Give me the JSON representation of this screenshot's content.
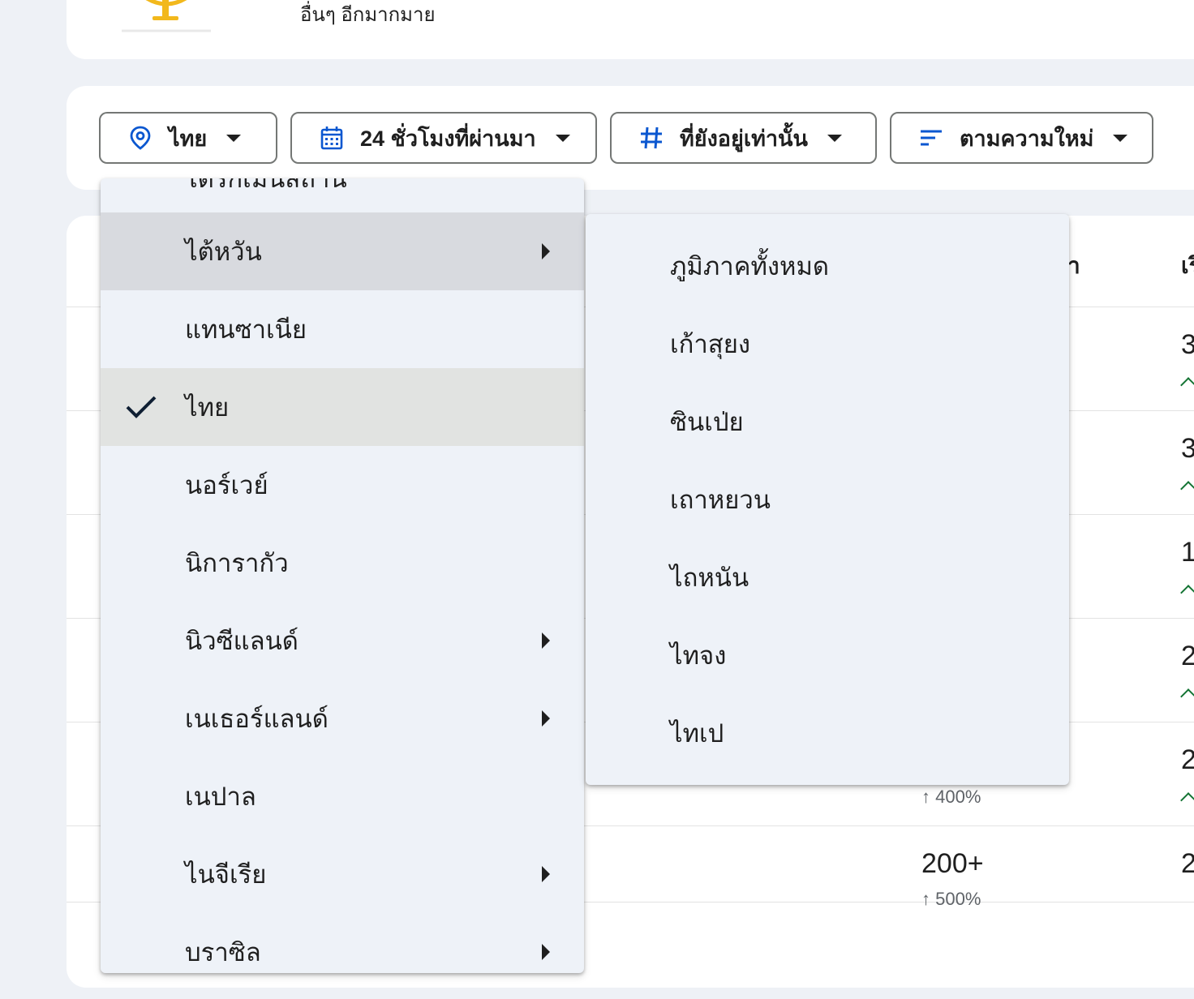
{
  "banner": {
    "text": "อื่นๆ อีกมากมาย",
    "logo_icon": "globe-trophy-icon"
  },
  "filters": {
    "location": {
      "label": "ไทย",
      "icon": "location-pin-icon"
    },
    "time": {
      "label": "24 ชั่วโมงที่ผ่านมา",
      "icon": "calendar-icon"
    },
    "status": {
      "label": "ที่ยังอยู่เท่านั้น",
      "icon": "hashtag-icon"
    },
    "sort": {
      "label": "ตามความใหม่",
      "icon": "sort-icon"
    }
  },
  "table": {
    "header_partial_mid": "า",
    "header_partial_right": "เริ",
    "rows": [
      {
        "edge_value": "3"
      },
      {
        "edge_value": "3"
      },
      {
        "edge_value": "1"
      },
      {
        "edge_value": "2"
      },
      {
        "volume": "",
        "change": "↑ 400%",
        "edge_value": "2"
      },
      {
        "volume": "200+",
        "change": "↑ 500%",
        "edge_value": "2"
      }
    ]
  },
  "location_menu": {
    "partial_top_item": "ไตรกิเมนิสถาน",
    "items": [
      {
        "label": "ไต้หวัน",
        "has_submenu": true,
        "state": "hover"
      },
      {
        "label": "แทนซาเนีย",
        "has_submenu": false,
        "state": ""
      },
      {
        "label": "ไทย",
        "has_submenu": false,
        "state": "selected"
      },
      {
        "label": "นอร์เวย์",
        "has_submenu": false,
        "state": ""
      },
      {
        "label": "นิการากัว",
        "has_submenu": false,
        "state": ""
      },
      {
        "label": "นิวซีแลนด์",
        "has_submenu": true,
        "state": ""
      },
      {
        "label": "เนเธอร์แลนด์",
        "has_submenu": true,
        "state": ""
      },
      {
        "label": "เนปาล",
        "has_submenu": false,
        "state": ""
      },
      {
        "label": "ไนจีเรีย",
        "has_submenu": true,
        "state": ""
      },
      {
        "label": "บราซิล",
        "has_submenu": true,
        "state": ""
      }
    ]
  },
  "region_submenu": {
    "items": [
      {
        "label": "ภูมิภาคทั้งหมด"
      },
      {
        "label": "เก้าสุยง"
      },
      {
        "label": "ซินเป่ย"
      },
      {
        "label": "เถาหยวน"
      },
      {
        "label": "ไถหนัน"
      },
      {
        "label": "ไทจง"
      },
      {
        "label": "ไทเป"
      }
    ]
  },
  "colors": {
    "accent_blue": "#0b57d0",
    "trend_green": "#137333",
    "menu_bg": "#eef2f8",
    "page_bg": "#eef1f6"
  }
}
